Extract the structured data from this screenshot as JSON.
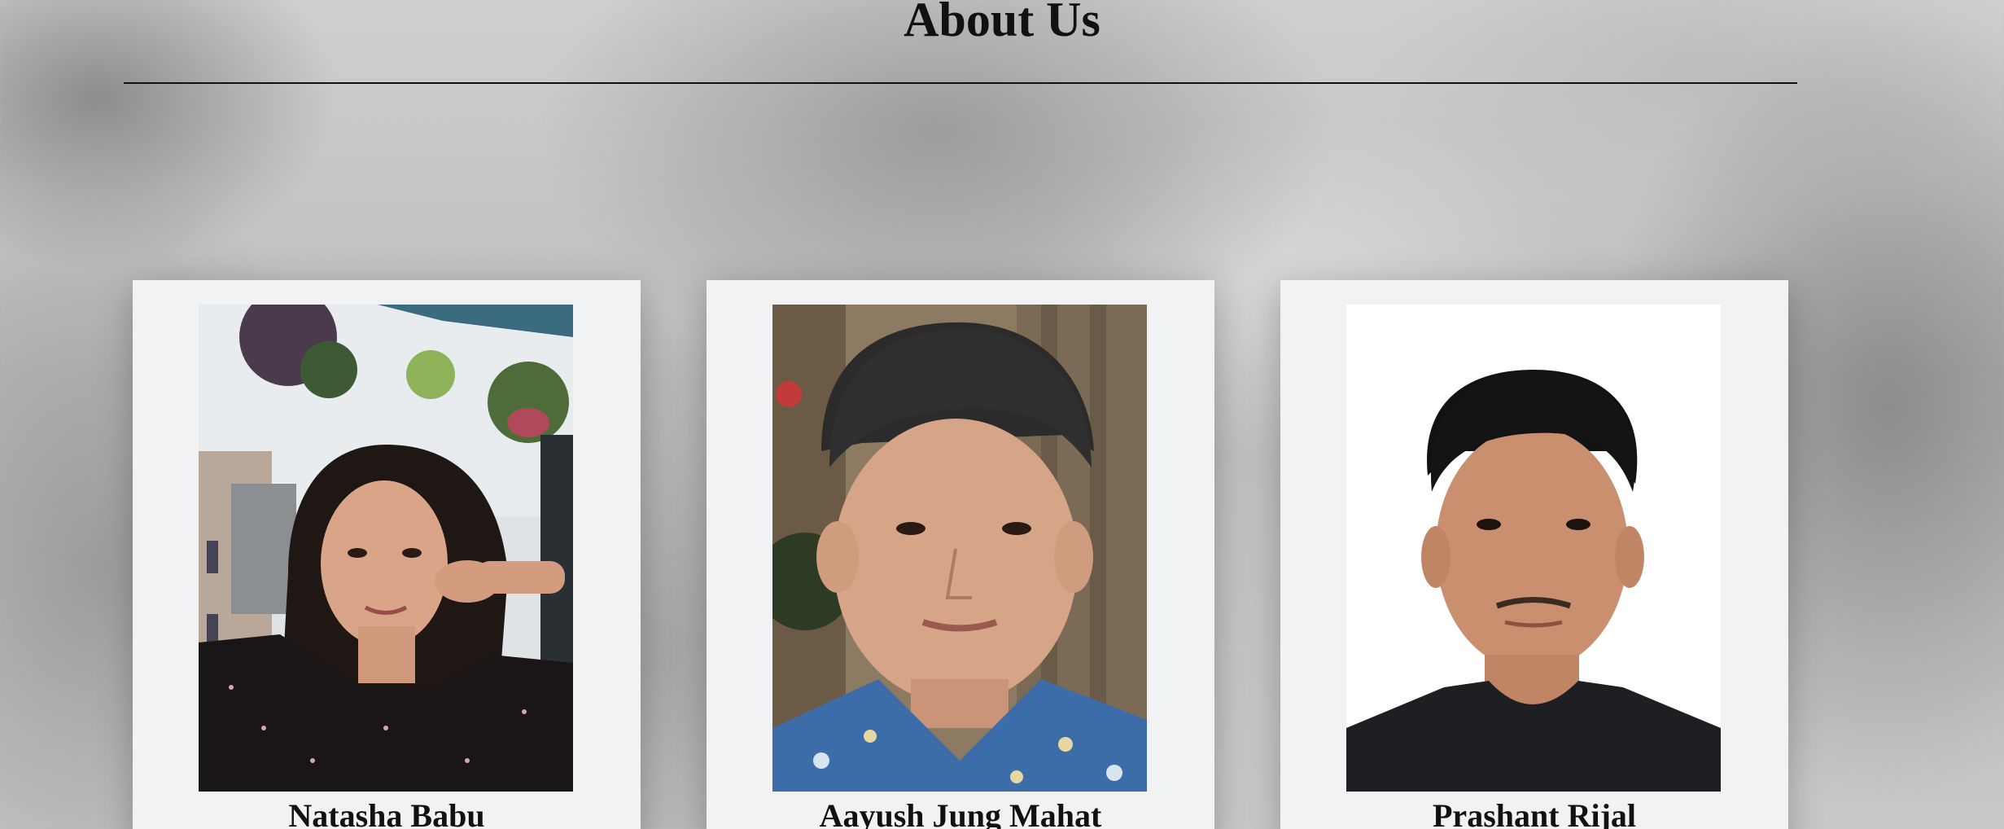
{
  "page": {
    "title": "About Us"
  },
  "team": [
    {
      "name": "Natasha Babu"
    },
    {
      "name": "Aayush Jung Mahat"
    },
    {
      "name": "Prashant Rijal"
    }
  ],
  "colors": {
    "card_background": "#f1f2f4",
    "text": "#111111",
    "background_tone": "grey watercolor"
  }
}
